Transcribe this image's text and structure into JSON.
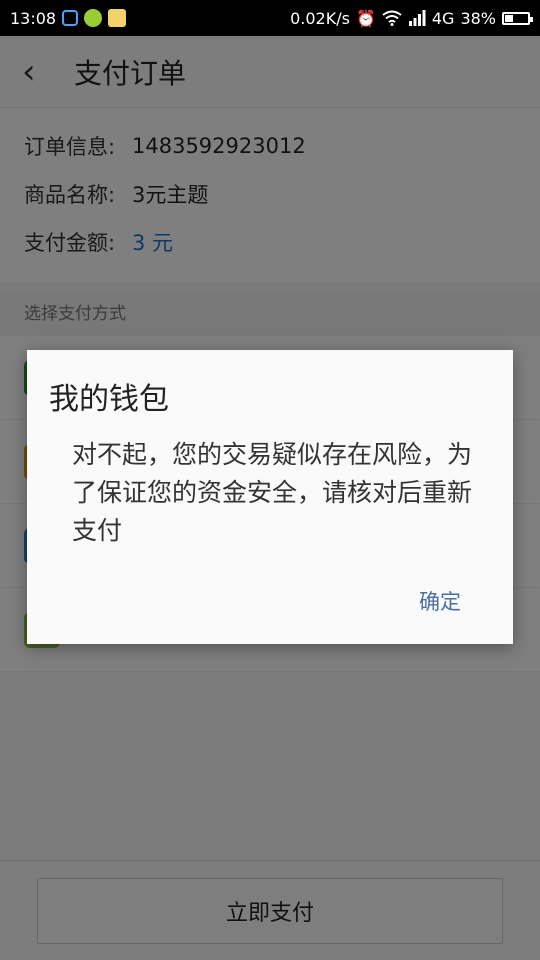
{
  "status_bar": {
    "time": "13:08",
    "speed": "0.02K/s",
    "network": "4G",
    "battery": "38%",
    "battery_level": 0.38,
    "icons": [
      "notification-icon",
      "app-icon",
      "app-icon",
      "alarm-icon",
      "wifi-icon",
      "signal-icon",
      "battery-icon"
    ]
  },
  "header": {
    "back_icon": "chevron-left-icon",
    "title": "支付订单"
  },
  "order": {
    "rows": [
      {
        "label": "订单信息:",
        "value": "1483592923012"
      },
      {
        "label": "商品名称:",
        "value": "3元主题"
      },
      {
        "label": "支付金额:",
        "value": "3 元"
      }
    ]
  },
  "payment": {
    "section_title": "选择支付方式",
    "method_colors": [
      "#2a9d2a",
      "#e0a000",
      "#1a8ad8",
      "#8bc34a"
    ]
  },
  "pay_button": "立即支付",
  "dialog": {
    "title": "我的钱包",
    "message": "对不起，您的交易疑似存在风险，为了保证您的资金安全，请核对后重新支付",
    "ok": "确定"
  },
  "colors": {
    "amount": "#1e6fd0",
    "dialog_ok": "#4a6fa5"
  }
}
